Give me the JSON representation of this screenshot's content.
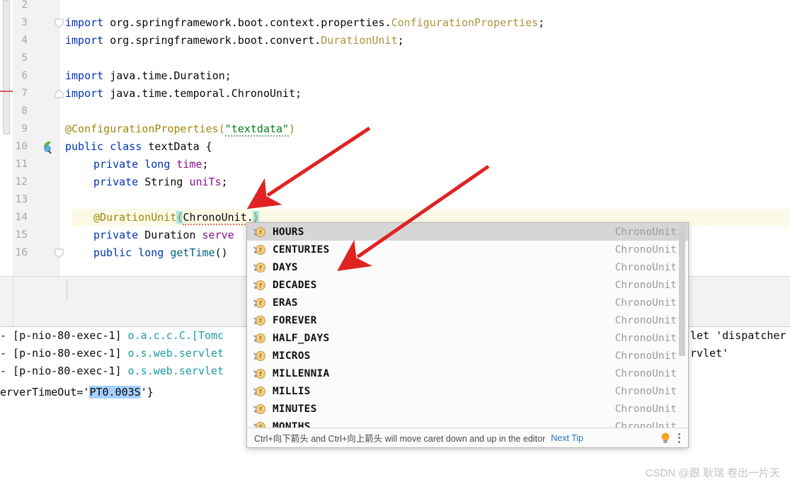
{
  "editor": {
    "lines": [
      {
        "num": "2",
        "fold": "",
        "gutter_icon": ""
      },
      {
        "num": "3",
        "fold": "collapse-down",
        "gutter_icon": ""
      },
      {
        "num": "4",
        "fold": "",
        "gutter_icon": ""
      },
      {
        "num": "5",
        "fold": "",
        "gutter_icon": ""
      },
      {
        "num": "6",
        "fold": "",
        "gutter_icon": ""
      },
      {
        "num": "7",
        "fold": "collapse-up",
        "gutter_icon": ""
      },
      {
        "num": "8",
        "fold": "",
        "gutter_icon": ""
      },
      {
        "num": "9",
        "fold": "",
        "gutter_icon": ""
      },
      {
        "num": "10",
        "fold": "",
        "gutter_icon": "spring-bean-icon"
      },
      {
        "num": "11",
        "fold": "",
        "gutter_icon": ""
      },
      {
        "num": "12",
        "fold": "",
        "gutter_icon": ""
      },
      {
        "num": "13",
        "fold": "",
        "gutter_icon": ""
      },
      {
        "num": "14",
        "fold": "",
        "gutter_icon": ""
      },
      {
        "num": "15",
        "fold": "",
        "gutter_icon": ""
      },
      {
        "num": "16",
        "fold": "collapse-down",
        "gutter_icon": ""
      }
    ],
    "code": {
      "l3_kw": "import",
      "l3_pkg": " org.springframework.boot.context.properties.",
      "l3_type": "ConfigurationProperties",
      "l3_semi": ";",
      "l4_kw": "import",
      "l4_pkg": " org.springframework.boot.convert.",
      "l4_type": "DurationUnit",
      "l4_semi": ";",
      "l6_kw": "import",
      "l6_rest": " java.time.Duration;",
      "l7_kw": "import",
      "l7_rest": " java.time.temporal.ChronoUnit;",
      "l9_anno": "@ConfigurationProperties",
      "l9_paren_open": "(",
      "l9_str": "\"textdata\"",
      "l9_paren_close": ")",
      "l10_kw1": "public",
      "l10_kw2": " class",
      "l10_name": " textData",
      "l10_brace": " {",
      "l11_kw1": "private",
      "l11_kw2": " long",
      "l11_field": " time",
      "l11_semi": ";",
      "l12_kw1": "private",
      "l12_type": " String",
      "l12_field": " uniTs",
      "l12_semi": ";",
      "l13_anno": "@DurationUnit",
      "l13_open": "(",
      "l13_expr": "ChronoUnit.",
      "l13_close": ")",
      "l14_kw": "private",
      "l14_type": " Duration",
      "l14_field": " serve",
      "l16_kw1": "public",
      "l16_kw2": " long",
      "l16_meth": " getTime",
      "l16_parens": "()"
    },
    "highlighted_line": "13",
    "colors": {
      "keyword": "#0033b3",
      "annotation": "#9e880d",
      "string": "#067d17",
      "field": "#871094",
      "method": "#00627a",
      "type_ref": "#a9953c",
      "current_line_bg": "#fcfae7",
      "bracket_match_bg": "#a8e6e6",
      "gutter_bg": "#f2f2f2"
    }
  },
  "console": {
    "lines": [
      {
        "prefix": "- [p-nio-80-exec-1] ",
        "logger": "o.a.c.c.C.[Tomc",
        "tail": "let 'dispatcher"
      },
      {
        "prefix": "- [p-nio-80-exec-1] ",
        "logger": "o.s.web.servlet",
        "tail": "rvlet'"
      },
      {
        "prefix": "- [p-nio-80-exec-1] ",
        "logger": "o.s.web.servlet",
        "tail": ""
      }
    ],
    "result_line": {
      "before": "erverTimeOut='",
      "highlight": "PT0.003S",
      "after": "'}"
    },
    "highlight_color": "#a6d2ff",
    "logger_color": "#1a9ba8"
  },
  "popup": {
    "items": [
      {
        "name": "HOURS",
        "type": "ChronoUnit",
        "icon": "field-icon",
        "selected": true
      },
      {
        "name": "CENTURIES",
        "type": "ChronoUnit",
        "icon": "field-icon",
        "selected": false
      },
      {
        "name": "DAYS",
        "type": "ChronoUnit",
        "icon": "field-icon",
        "selected": false
      },
      {
        "name": "DECADES",
        "type": "ChronoUnit",
        "icon": "field-icon",
        "selected": false
      },
      {
        "name": "ERAS",
        "type": "ChronoUnit",
        "icon": "field-icon",
        "selected": false
      },
      {
        "name": "FOREVER",
        "type": "ChronoUnit",
        "icon": "field-icon",
        "selected": false
      },
      {
        "name": "HALF_DAYS",
        "type": "ChronoUnit",
        "icon": "field-icon",
        "selected": false
      },
      {
        "name": "MICROS",
        "type": "ChronoUnit",
        "icon": "field-icon",
        "selected": false
      },
      {
        "name": "MILLENNIA",
        "type": "ChronoUnit",
        "icon": "field-icon",
        "selected": false
      },
      {
        "name": "MILLIS",
        "type": "ChronoUnit",
        "icon": "field-icon",
        "selected": false
      },
      {
        "name": "MINUTES",
        "type": "ChronoUnit",
        "icon": "field-icon",
        "selected": false
      },
      {
        "name": "MONTHS",
        "type": "ChronoUnit",
        "icon": "field-icon",
        "selected": false
      }
    ],
    "footer": {
      "tip": "Ctrl+向下箭头 and Ctrl+向上箭头 will move caret down and up in the editor",
      "next_tip_label": "Next Tip",
      "bulb_icon": "lightbulb-icon",
      "menu_icon": "kebab-menu-icon"
    },
    "selected_bg": "#d6d6d6",
    "type_color": "#9a9a9a"
  },
  "annotations": {
    "arrow_color": "#e02222",
    "arrow_1": "points at ChronoUnit. caret on line 13",
    "arrow_2": "points at DAYS item in completion list"
  },
  "watermark": {
    "text": "CSDN @跟 耿瑞 卷出一片天"
  }
}
